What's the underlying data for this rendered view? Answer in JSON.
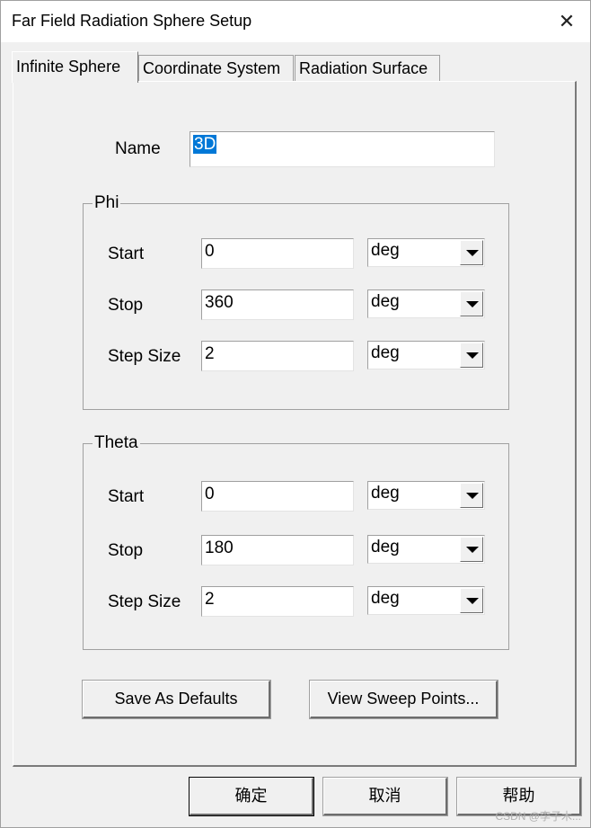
{
  "window": {
    "title": "Far Field Radiation Sphere Setup",
    "close_glyph": "✕"
  },
  "tabs": [
    {
      "label": "Infinite Sphere",
      "active": true
    },
    {
      "label": "Coordinate System",
      "active": false
    },
    {
      "label": "Radiation Surface",
      "active": false
    }
  ],
  "name_field": {
    "label": "Name",
    "value": "3D"
  },
  "phi": {
    "title": "Phi",
    "rows": [
      {
        "label": "Start",
        "value": "0",
        "unit": "deg"
      },
      {
        "label": "Stop",
        "value": "360",
        "unit": "deg"
      },
      {
        "label": "Step Size",
        "value": "2",
        "unit": "deg"
      }
    ]
  },
  "theta": {
    "title": "Theta",
    "rows": [
      {
        "label": "Start",
        "value": "0",
        "unit": "deg"
      },
      {
        "label": "Stop",
        "value": "180",
        "unit": "deg"
      },
      {
        "label": "Step Size",
        "value": "2",
        "unit": "deg"
      }
    ]
  },
  "actions": {
    "save_defaults": "Save As Defaults",
    "view_sweep": "View Sweep Points..."
  },
  "footer": {
    "ok": "确定",
    "cancel": "取消",
    "help": "帮助"
  },
  "watermark": "CSDN @李子木..."
}
